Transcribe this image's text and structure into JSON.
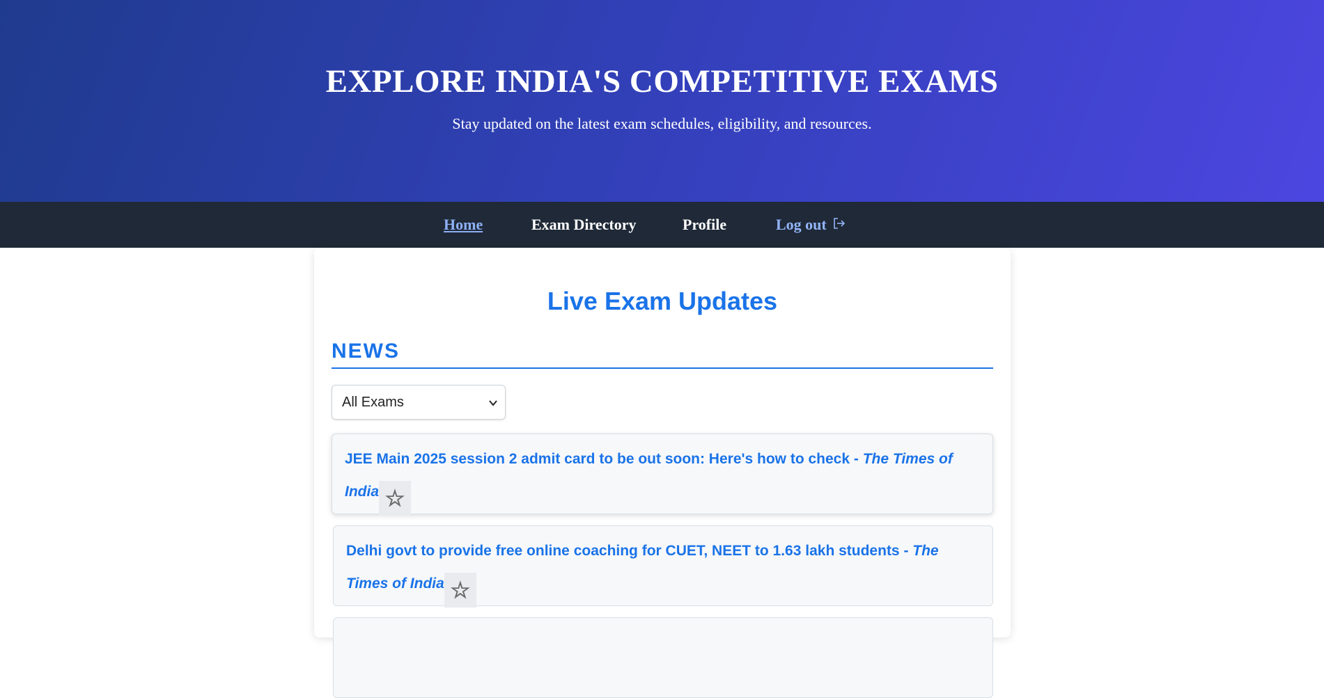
{
  "hero": {
    "title": "EXPLORE INDIA'S COMPETITIVE EXAMS",
    "subtitle": "Stay updated on the latest exam schedules, eligibility, and resources."
  },
  "nav": {
    "home": "Home",
    "exam_directory": "Exam Directory",
    "profile": "Profile",
    "logout": "Log out",
    "logout_icon": "logout-icon"
  },
  "main": {
    "title": "Live Exam Updates",
    "news_heading": "NEWS",
    "filter": {
      "selected": "All Exams"
    },
    "news": [
      {
        "headline": "JEE Main 2025 session 2 admit card to be out soon: Here's how to check - ",
        "source": "The Times of India",
        "star": "☆"
      },
      {
        "headline": "Delhi govt to provide free online coaching for CUET, NEET to 1.63 lakh students - ",
        "source": "The Times of India",
        "star": "☆"
      }
    ]
  },
  "colors": {
    "accent": "#1a73e8",
    "nav_bg": "#1f2937",
    "hero_start": "#1f3b8e",
    "hero_end": "#4c46e0"
  }
}
